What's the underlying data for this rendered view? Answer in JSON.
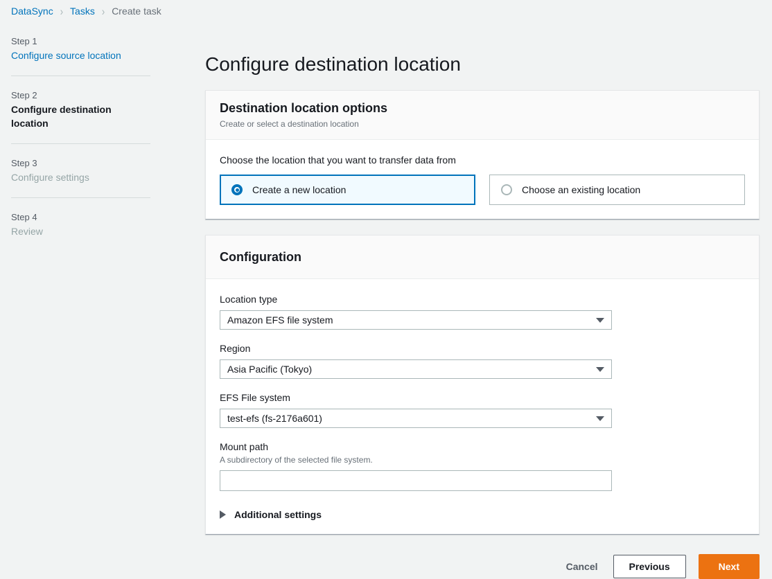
{
  "breadcrumb": {
    "items": [
      {
        "label": "DataSync",
        "current": false
      },
      {
        "label": "Tasks",
        "current": false
      },
      {
        "label": "Create task",
        "current": true
      }
    ],
    "separator": "›"
  },
  "sidebar": {
    "steps": [
      {
        "number": "Step 1",
        "title": "Configure source location",
        "state": "link"
      },
      {
        "number": "Step 2",
        "title": "Configure destination location",
        "state": "active"
      },
      {
        "number": "Step 3",
        "title": "Configure settings",
        "state": "disabled"
      },
      {
        "number": "Step 4",
        "title": "Review",
        "state": "disabled"
      }
    ]
  },
  "main": {
    "page_title": "Configure destination location",
    "options_card": {
      "title": "Destination location options",
      "subtitle": "Create or select a destination location",
      "choice_label": "Choose the location that you want to transfer data from",
      "tiles": [
        {
          "label": "Create a new location",
          "selected": true
        },
        {
          "label": "Choose an existing location",
          "selected": false
        }
      ]
    },
    "configuration_card": {
      "title": "Configuration",
      "fields": {
        "location_type": {
          "label": "Location type",
          "value": "Amazon EFS file system"
        },
        "region": {
          "label": "Region",
          "value": "Asia Pacific (Tokyo)"
        },
        "efs_file_system": {
          "label": "EFS File system",
          "value": "test-efs (fs-2176a601)"
        },
        "mount_path": {
          "label": "Mount path",
          "description": "A subdirectory of the selected file system.",
          "value": "",
          "placeholder": ""
        }
      },
      "additional_settings": {
        "label": "Additional settings",
        "expanded": false
      }
    }
  },
  "footer": {
    "cancel_label": "Cancel",
    "previous_label": "Previous",
    "next_label": "Next"
  },
  "colors": {
    "accent_blue": "#0073bb",
    "primary_orange": "#ec7211",
    "page_background": "#f1f3f3",
    "selected_tile_background": "#f1faff"
  }
}
